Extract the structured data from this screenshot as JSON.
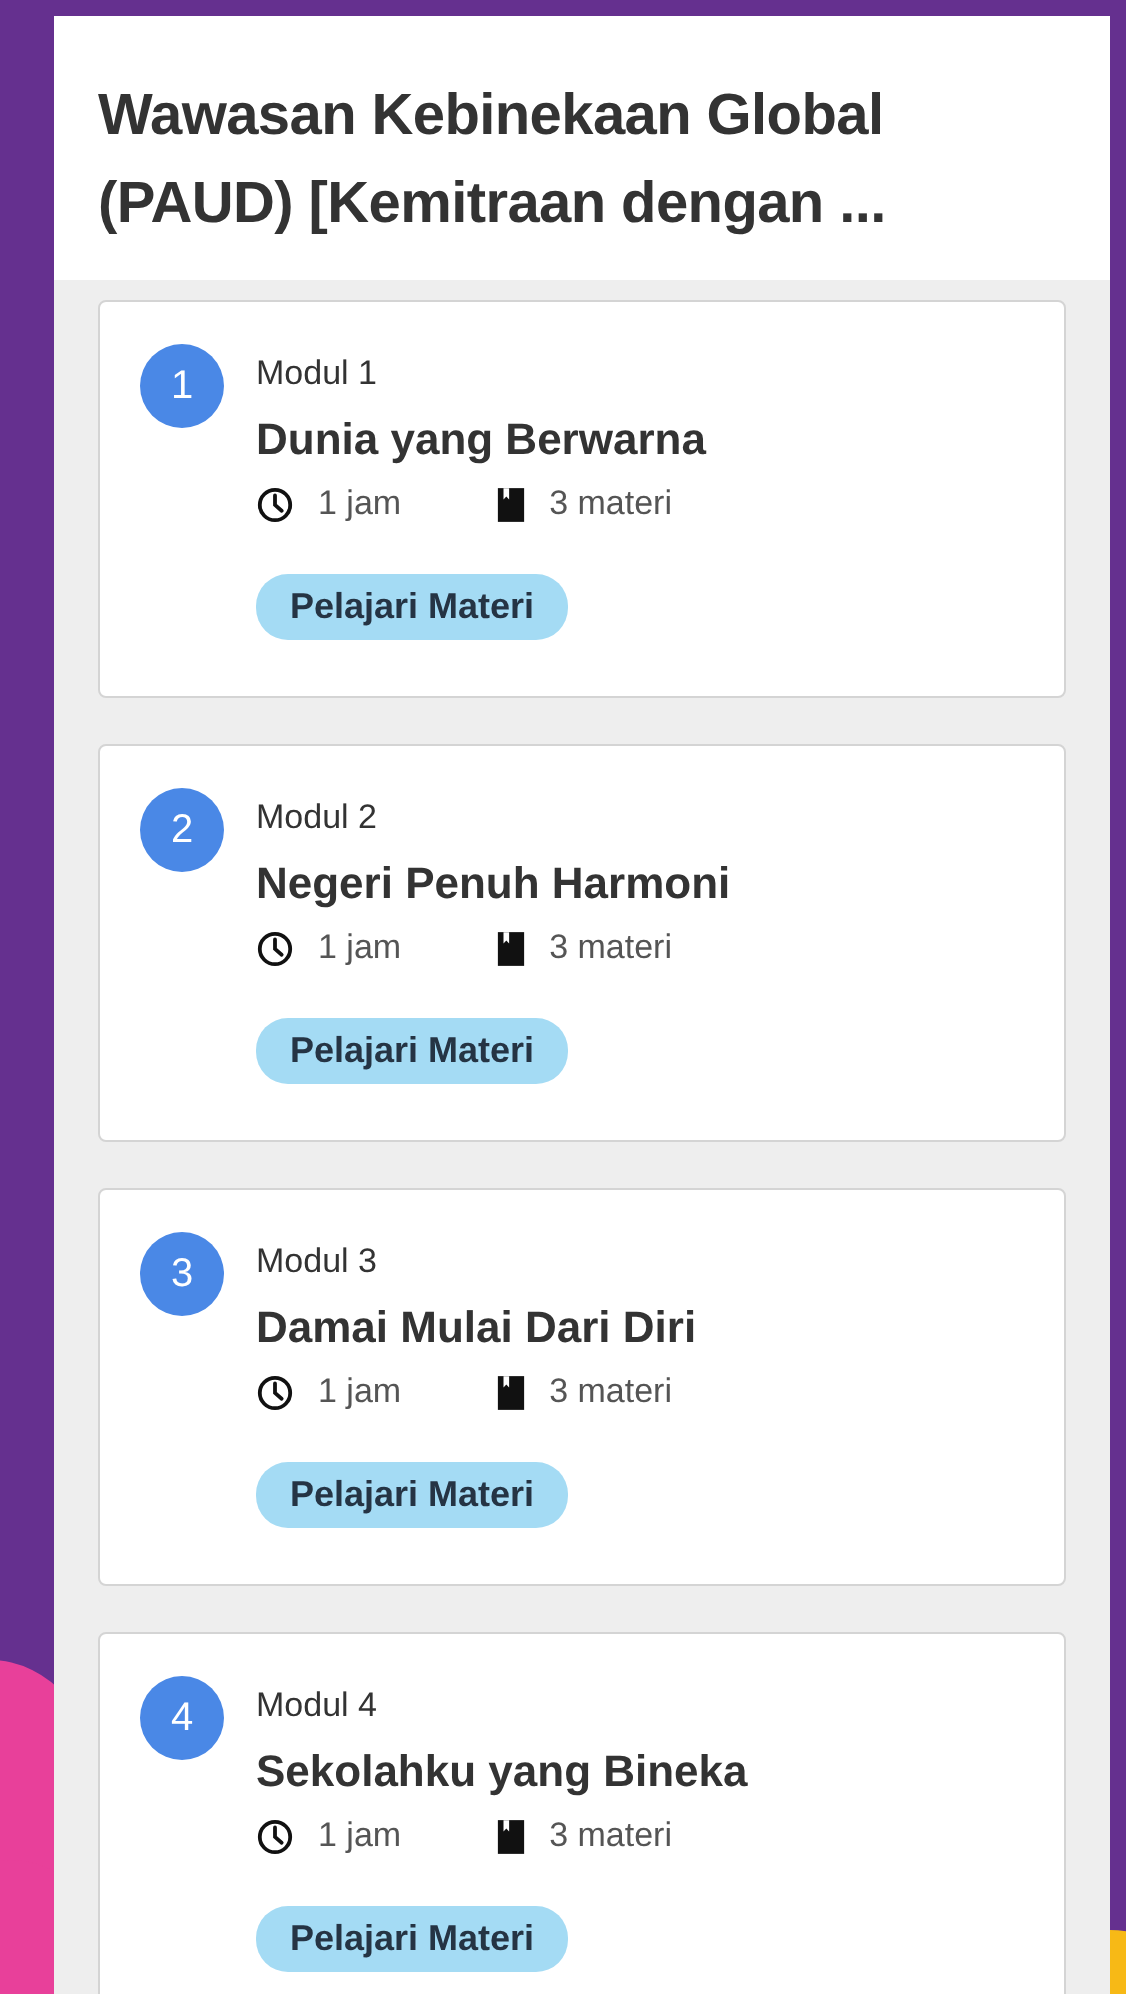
{
  "header": {
    "title": "Wawasan Kebinekaan Global (PAUD) [Kemitraan dengan ..."
  },
  "modules": [
    {
      "number": "1",
      "label": "Modul 1",
      "title": "Dunia yang Berwarna",
      "duration": "1 jam",
      "materials": "3 materi",
      "button": "Pelajari Materi"
    },
    {
      "number": "2",
      "label": "Modul 2",
      "title": "Negeri Penuh Harmoni",
      "duration": "1 jam",
      "materials": "3 materi",
      "button": "Pelajari Materi"
    },
    {
      "number": "3",
      "label": "Modul 3",
      "title": "Damai Mulai Dari Diri",
      "duration": "1 jam",
      "materials": "3 materi",
      "button": "Pelajari Materi"
    },
    {
      "number": "4",
      "label": "Modul 4",
      "title": "Sekolahku yang Bineka",
      "duration": "1 jam",
      "materials": "3 materi",
      "button": "Pelajari Materi"
    }
  ]
}
